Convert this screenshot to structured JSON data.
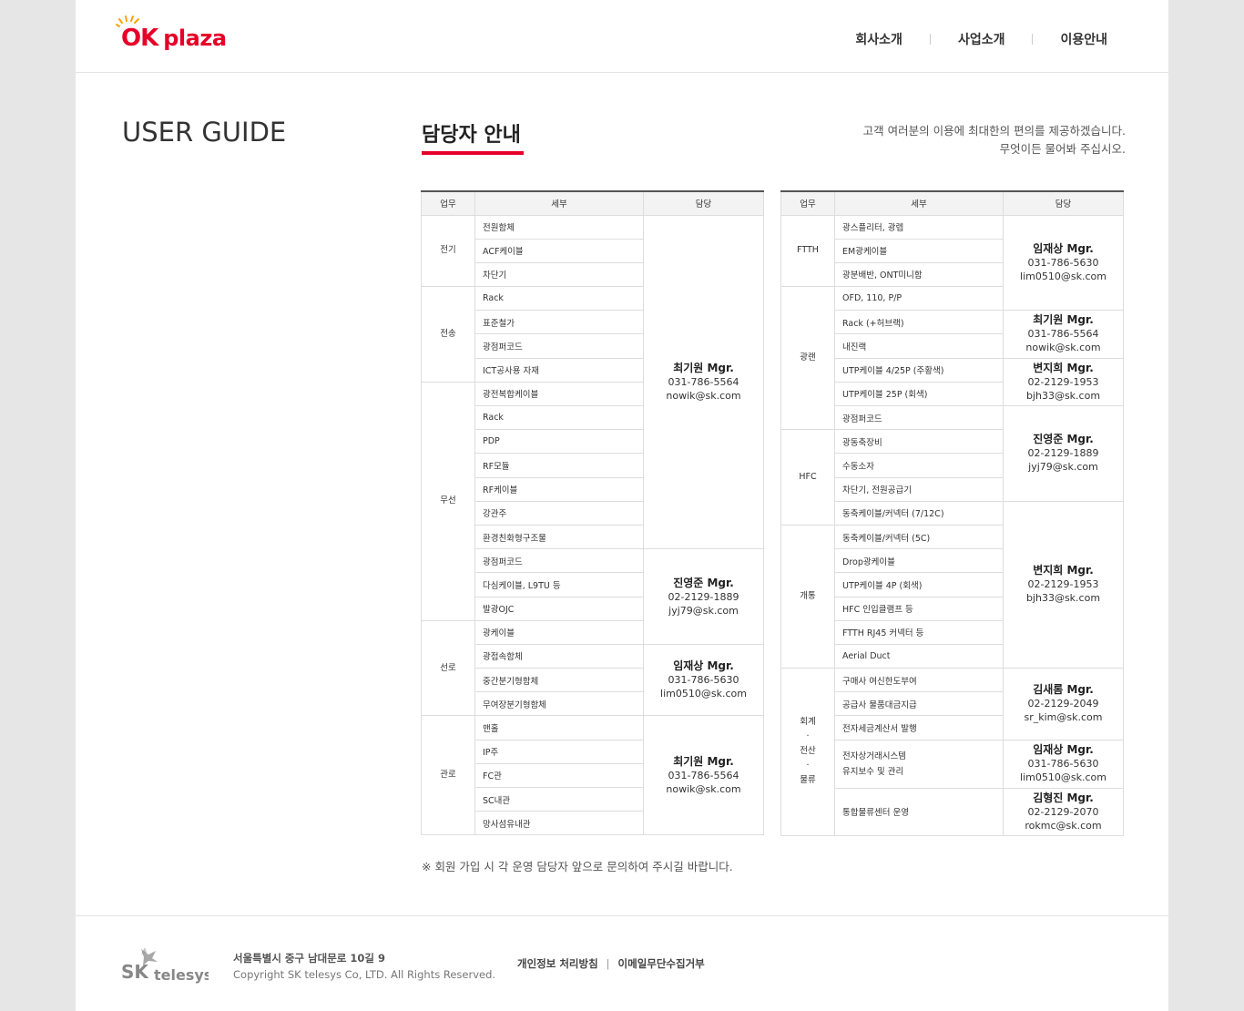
{
  "header": {
    "logo_text_ok": "OK",
    "logo_text_plaza": "plaza",
    "nav": [
      "회사소개",
      "사업소개",
      "이용안내"
    ]
  },
  "page": {
    "guide_title": "USER GUIDE",
    "section_title": "담당자 안내",
    "intro_line1": "고객 여러분의 이용에 최대한의 편의를 제공하겠습니다.",
    "intro_line2": "무엇이든 물어봐 주십시오.",
    "notice": "※ 회원 가입 시 각 운영 담당자 앞으로 문의하여 주시길 바랍니다."
  },
  "table_headers": [
    "업무",
    "세부",
    "담당"
  ],
  "left_table": {
    "categories": [
      "전기",
      "전송",
      "무선",
      "선로",
      "관로"
    ],
    "details": [
      "전원함체",
      "ACF케이블",
      "차단기",
      "Rack",
      "표준철가",
      "광점퍼코드",
      "ICT공사용 자재",
      "광전복합케이블",
      "Rack",
      "PDP",
      "RF모듈",
      "RF케이블",
      "강관주",
      "환경친화형구조물",
      "광점퍼코드",
      "다심케이블, L9TU 등",
      "발광OJC",
      "광케이블",
      "광접속함체",
      "중간분기형함체",
      "무여장분기형함체",
      "맨홀",
      "IP주",
      "FC관",
      "SC내관",
      "망사섬유내관"
    ],
    "contacts": [
      {
        "name": "최기원 Mgr.",
        "phone": "031-786-5564",
        "email": "nowik@sk.com"
      },
      {
        "name": "진영준 Mgr.",
        "phone": "02-2129-1889",
        "email": "jyj79@sk.com"
      },
      {
        "name": "임재상 Mgr.",
        "phone": "031-786-5630",
        "email": "lim0510@sk.com"
      },
      {
        "name": "최기원 Mgr.",
        "phone": "031-786-5564",
        "email": "nowik@sk.com"
      }
    ]
  },
  "right_table": {
    "categories": [
      "FTTH",
      "광랜",
      "HFC",
      "개통",
      "회계\n·\n전산\n·\n물류"
    ],
    "cat_lines": [
      "회계",
      "·",
      "전산",
      "·",
      "물류"
    ],
    "details": [
      "광스플리터, 광렙",
      "EM광케이블",
      "광분배반, ONT미니함",
      "OFD, 110, P/P",
      "Rack (+허브랙)",
      "내진랙",
      "UTP케이블 4/25P (주황색)",
      "UTP케이블 25P (회색)",
      "광점퍼코드",
      "광동축장비",
      "수동소자",
      "차단기, 전원공급기",
      "동축케이블/커넥터 (7/12C)",
      "동축케이블/커넥터 (5C)",
      "Drop광케이블",
      "UTP케이블 4P (회색)",
      "HFC 인입클램프 등",
      "FTTH RJ45 커넥터 등",
      "Aerial Duct",
      "구매사 여신한도부여",
      "공급사 물품대금지급",
      "전자세금계산서 발행",
      "전자상거래시스템",
      "유지보수 및 관리",
      "통합물류센터 운영"
    ],
    "contacts": [
      {
        "name": "임재상 Mgr.",
        "phone": "031-786-5630",
        "email": "lim0510@sk.com"
      },
      {
        "name": "최기원 Mgr.",
        "phone": "031-786-5564",
        "email": "nowik@sk.com"
      },
      {
        "name": "변지희 Mgr.",
        "phone": "02-2129-1953",
        "email": "bjh33@sk.com"
      },
      {
        "name": "진영준 Mgr.",
        "phone": "02-2129-1889",
        "email": "jyj79@sk.com"
      },
      {
        "name": "변지희 Mgr.",
        "phone": "02-2129-1953",
        "email": "bjh33@sk.com"
      },
      {
        "name": "김새롬 Mgr.",
        "phone": "02-2129-2049",
        "email": "sr_kim@sk.com"
      },
      {
        "name": "임재상 Mgr.",
        "phone": "031-786-5630",
        "email": "lim0510@sk.com"
      },
      {
        "name": "김형진 Mgr.",
        "phone": "02-2129-2070",
        "email": "rokmc@sk.com"
      }
    ]
  },
  "footer": {
    "brand_sk": "SK",
    "brand_telesys": "telesys",
    "address": "서울특별시 중구 남대문로 10길 9",
    "copyright": "Copyright SK telesys Co, LTD. All Rights Reserved.",
    "links": [
      "개인정보 처리방침",
      "이메일무단수집거부"
    ],
    "link_sep": "|"
  },
  "colors": {
    "brand_red": "#e60028",
    "footer_gray": "#999999"
  }
}
